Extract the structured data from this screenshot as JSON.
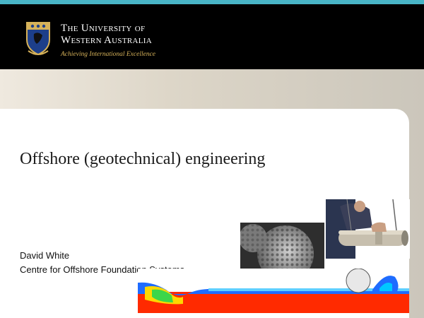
{
  "header": {
    "university_line1": "The University of",
    "university_line2": "Western Australia",
    "motto": "Achieving International Excellence"
  },
  "colors": {
    "accent_bar": "#48b4c6",
    "header_bg": "#000000",
    "motto": "#d6b25a"
  },
  "slide": {
    "title": "Offshore (geotechnical) engineering",
    "author": "David White",
    "affiliation": "Centre for Offshore Foundation Systems"
  },
  "icons": {
    "crest": "university-crest-icon"
  }
}
